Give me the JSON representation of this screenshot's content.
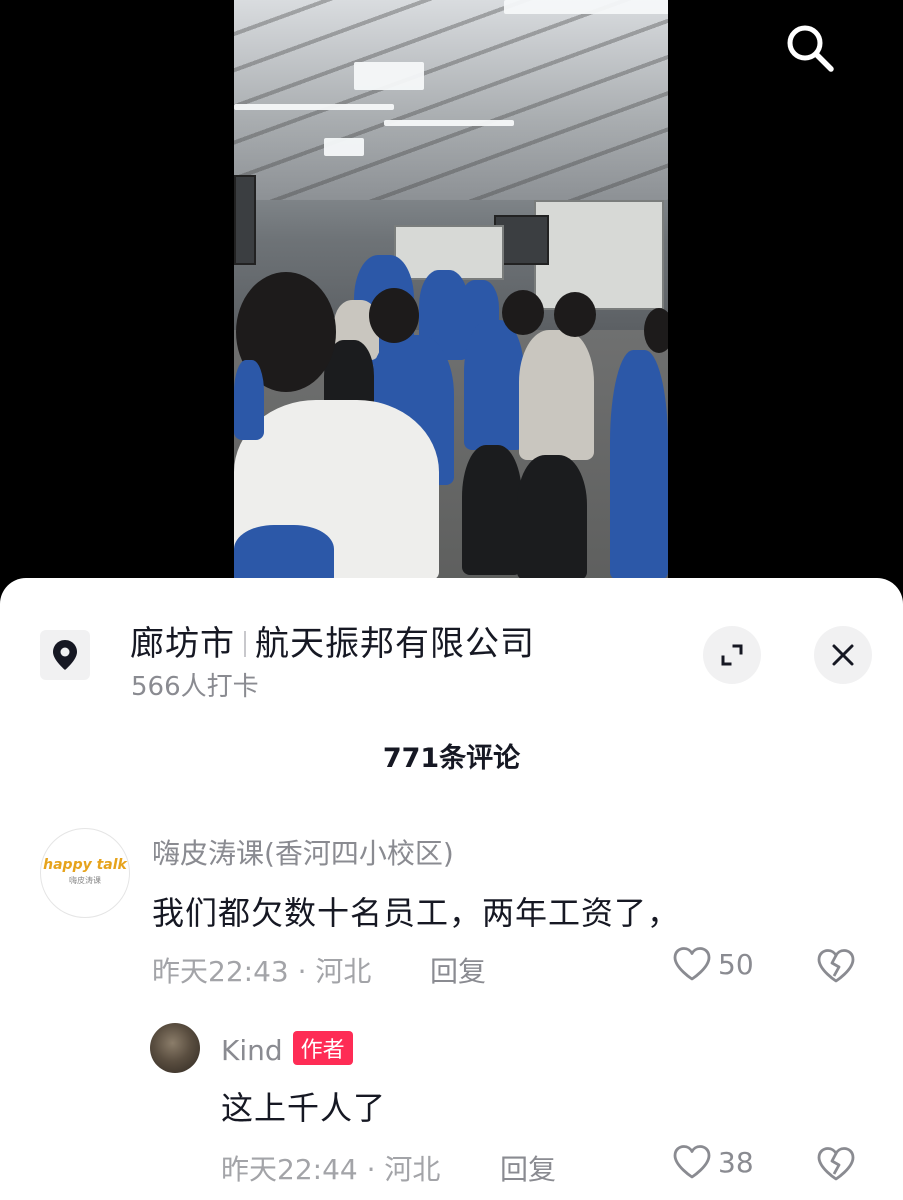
{
  "location": {
    "city": "廊坊市",
    "name": "航天振邦有限公司",
    "checkins": "566人打卡"
  },
  "comments_header": "771条评论",
  "comments": [
    {
      "user": "嗨皮涛课(香河四小校区)",
      "avatar_logo": "happy talk",
      "avatar_logo_sub": "嗨皮涛课",
      "text": "我们都欠数十名员工，两年工资了，",
      "meta": "昨天22:43 · 河北",
      "reply": "回复",
      "likes": "50"
    },
    {
      "user": "Kind",
      "badge": "作者",
      "text": "这上千人了",
      "meta": "昨天22:44 · 河北",
      "reply": "回复",
      "likes": "38"
    }
  ],
  "icons": {
    "search": "search-icon",
    "location": "location-pin-icon",
    "expand": "expand-icon",
    "close": "close-icon",
    "like": "heart-outline-icon",
    "dislike": "broken-heart-icon"
  },
  "colors": {
    "accent": "#fe2c55",
    "text_primary": "#161823",
    "text_secondary": "#8a8b91"
  }
}
